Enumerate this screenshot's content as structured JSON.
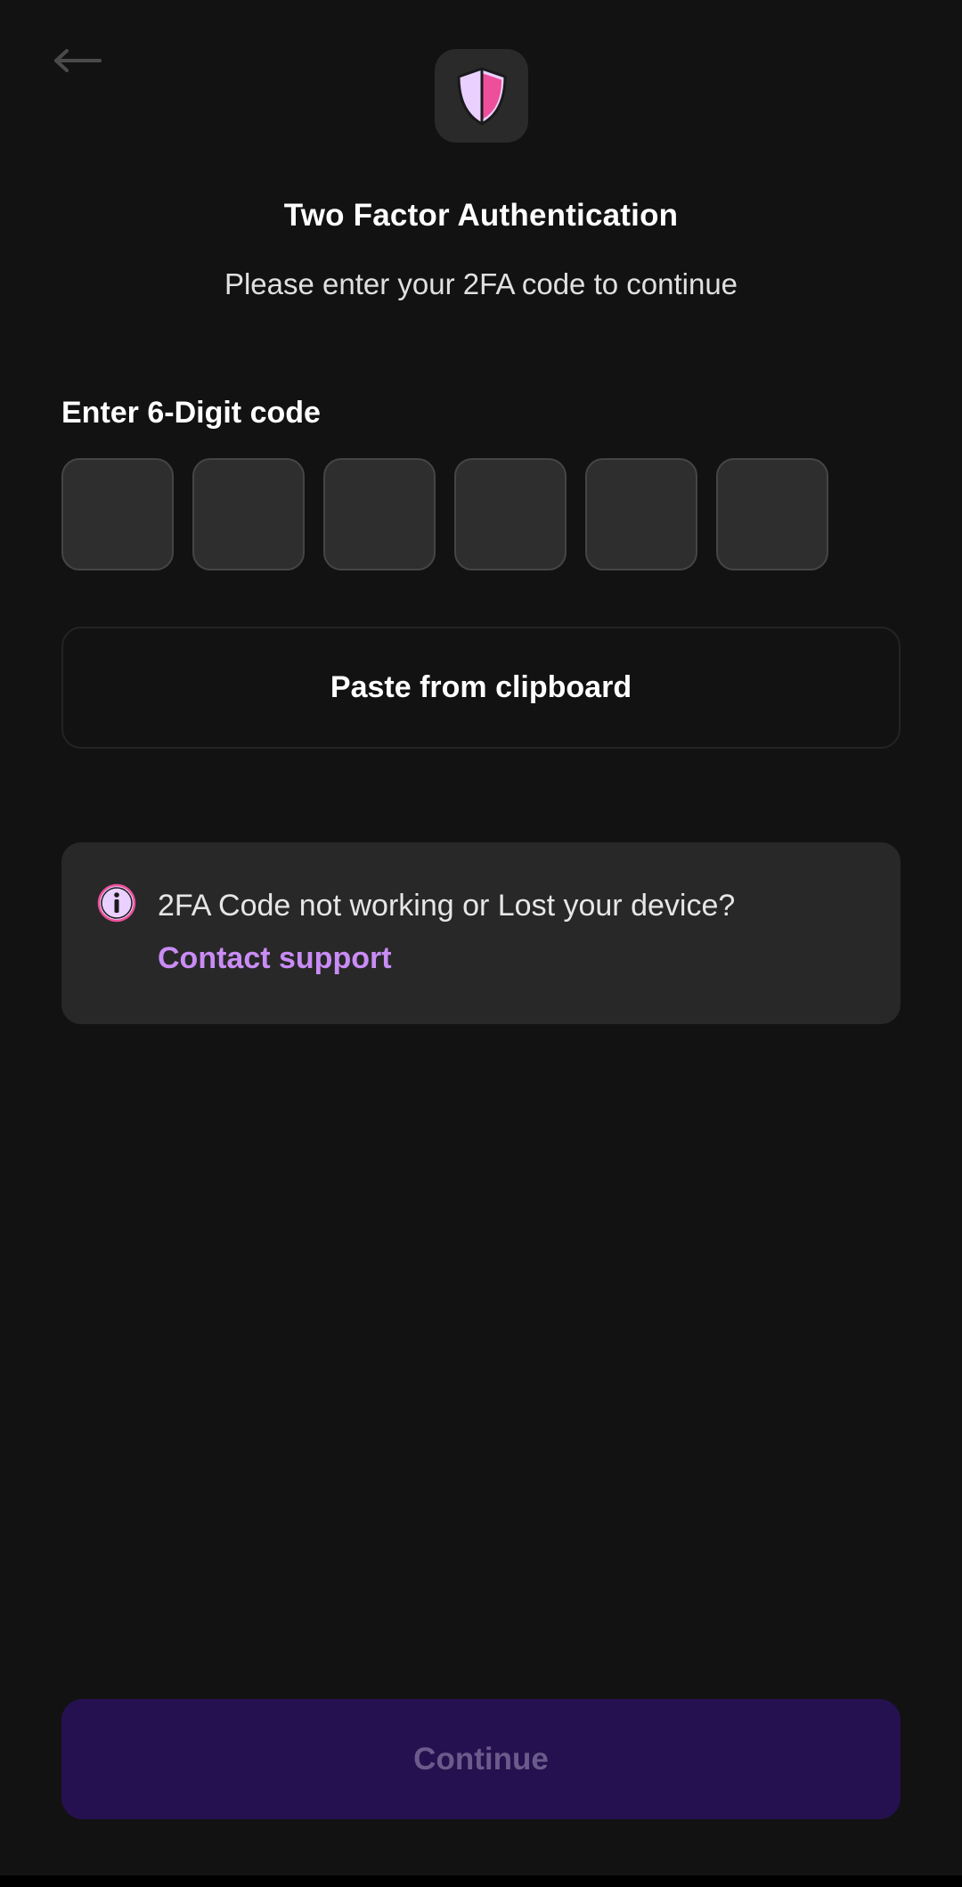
{
  "header": {
    "back_icon": "arrow-left-icon",
    "logo_icon": "shield-icon"
  },
  "title": "Two Factor Authentication",
  "subtitle": "Please enter your 2FA code to continue",
  "code": {
    "label": "Enter 6-Digit code",
    "digits": [
      "",
      "",
      "",
      "",
      "",
      ""
    ]
  },
  "paste_button": "Paste from clipboard",
  "help_card": {
    "icon": "info-icon",
    "message": "2FA Code not working or Lost your device?",
    "link": "Contact support"
  },
  "continue_button": "Continue",
  "colors": {
    "background": "#121212",
    "card": "#282828",
    "code_box": "#2e2e2e",
    "accent_link": "#c98cf5",
    "continue_bg_disabled": "#25114f",
    "continue_text_disabled": "#6b5a8b",
    "shield_light": "#ead0ff",
    "shield_pink": "#ee4f9a"
  }
}
